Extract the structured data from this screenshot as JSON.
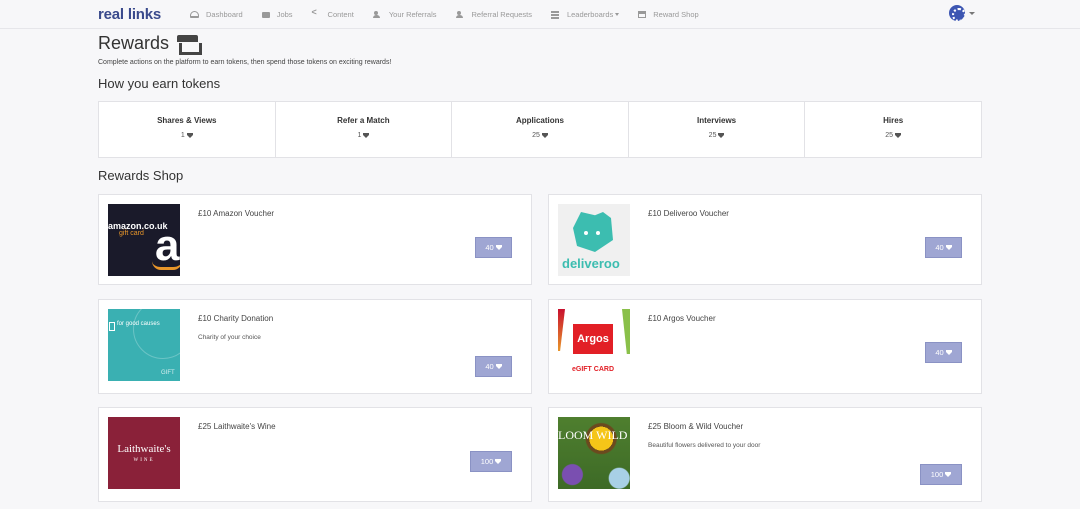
{
  "nav": {
    "brand": "real links",
    "items": [
      {
        "label": "Dashboard",
        "icon": "dashboard-icon"
      },
      {
        "label": "Jobs",
        "icon": "briefcase-icon"
      },
      {
        "label": "Content",
        "icon": "share-icon"
      },
      {
        "label": "Your Referrals",
        "icon": "user-plus-icon"
      },
      {
        "label": "Referral Requests",
        "icon": "user-plus-icon"
      },
      {
        "label": "Leaderboards",
        "icon": "list-icon"
      },
      {
        "label": "Reward Shop",
        "icon": "shop-icon"
      }
    ]
  },
  "page": {
    "title": "Rewards",
    "subtitle": "Complete actions on the platform to earn tokens, then spend those tokens on exciting rewards!"
  },
  "earn": {
    "title": "How you earn tokens",
    "items": [
      {
        "label": "Shares & Views",
        "value": "1"
      },
      {
        "label": "Refer a Match",
        "value": "1"
      },
      {
        "label": "Applications",
        "value": "25"
      },
      {
        "label": "Interviews",
        "value": "25"
      },
      {
        "label": "Hires",
        "value": "25"
      }
    ]
  },
  "shop": {
    "title": "Rewards Shop",
    "items": [
      {
        "title": "£10 Amazon Voucher",
        "description": "",
        "price": "40",
        "image_text": "amazon.co.uk",
        "image_sub": "gift card"
      },
      {
        "title": "£10 Deliveroo Voucher",
        "description": "",
        "price": "40",
        "image_text": "deliveroo"
      },
      {
        "title": "£10 Charity Donation",
        "description": "Charity of your choice",
        "price": "40",
        "image_text": "for good causes",
        "image_sub": "GIFT"
      },
      {
        "title": "£10 Argos Voucher",
        "description": "",
        "price": "40",
        "image_text": "Argos",
        "image_sub": "eGIFT CARD"
      },
      {
        "title": "£25 Laithwaite's Wine",
        "description": "",
        "price": "100",
        "image_text": "Laithwaite's",
        "image_sub": "WINE"
      },
      {
        "title": "£25 Bloom & Wild Voucher",
        "description": "Beautiful flowers delivered to your door",
        "price": "100",
        "image_text": "LOOM WILD"
      }
    ]
  }
}
